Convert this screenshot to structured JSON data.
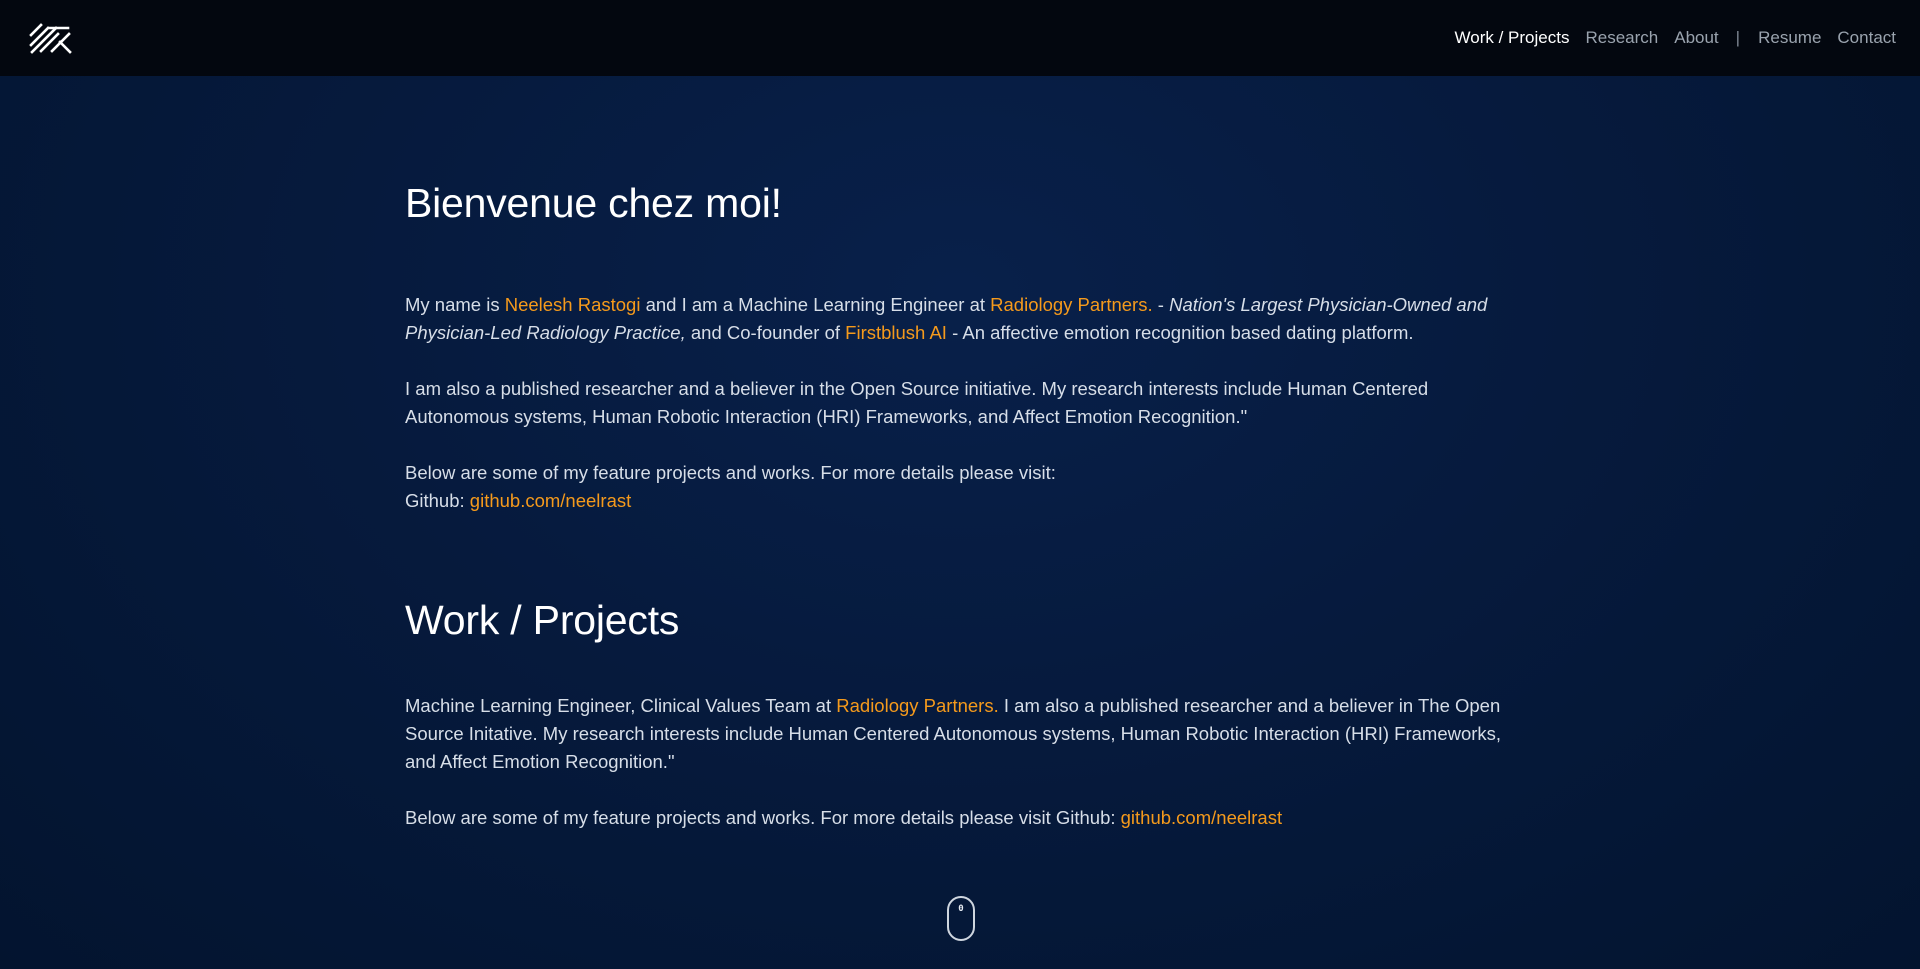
{
  "header": {
    "logo_icon": "nr-monogram-icon",
    "nav": {
      "work_projects": "Work / Projects",
      "research": "Research",
      "about": "About",
      "separator": "|",
      "resume": "Resume",
      "contact": "Contact"
    }
  },
  "intro": {
    "title": "Bienvenue chez moi!",
    "p1": {
      "t1": "My name is ",
      "name_link": "Neelesh Rastogi",
      "t2": " and I am a Machine Learning Engineer at ",
      "company_link": "Radiology Partners.",
      "t3": " - ",
      "company_desc": "Nation's Largest Physician-Owned and Physician-Led Radiology Practice,",
      "t4": " and Co-founder of ",
      "startup_link": "Firstblush AI",
      "t5": " - An affective emotion recognition based dating platform."
    },
    "p2": "I am also a published researcher and a believer in the Open Source initiative. My research interests include Human Centered Autonomous systems, Human Robotic Interaction (HRI) Frameworks, and Affect Emotion Recognition.\"",
    "p3": {
      "line1": "Below are some of my feature projects and works. For more details please visit:",
      "github_label": "Github: ",
      "github_link": "github.com/neelrast"
    }
  },
  "work": {
    "title": "Work / Projects",
    "p1": {
      "t1": "Machine Learning Engineer, Clinical Values Team at ",
      "company_link": "Radiology Partners.",
      "t2": " I am also a published researcher and a believer in The Open Source Initative. My research interests include Human Centered Autonomous systems, Human Robotic Interaction (HRI) Frameworks, and Affect Emotion Recognition.\""
    },
    "p2": {
      "t1": "Below are some of my feature projects and works. For more details please visit Github: ",
      "github_link": "github.com/neelrast"
    }
  },
  "scroll_indicator": {
    "icon": "scroll-mouse-icon",
    "wheel_text": "0"
  },
  "colors": {
    "accent": "#f59a1c",
    "header_bg": "#03070f",
    "page_bg": "#061a3d"
  }
}
